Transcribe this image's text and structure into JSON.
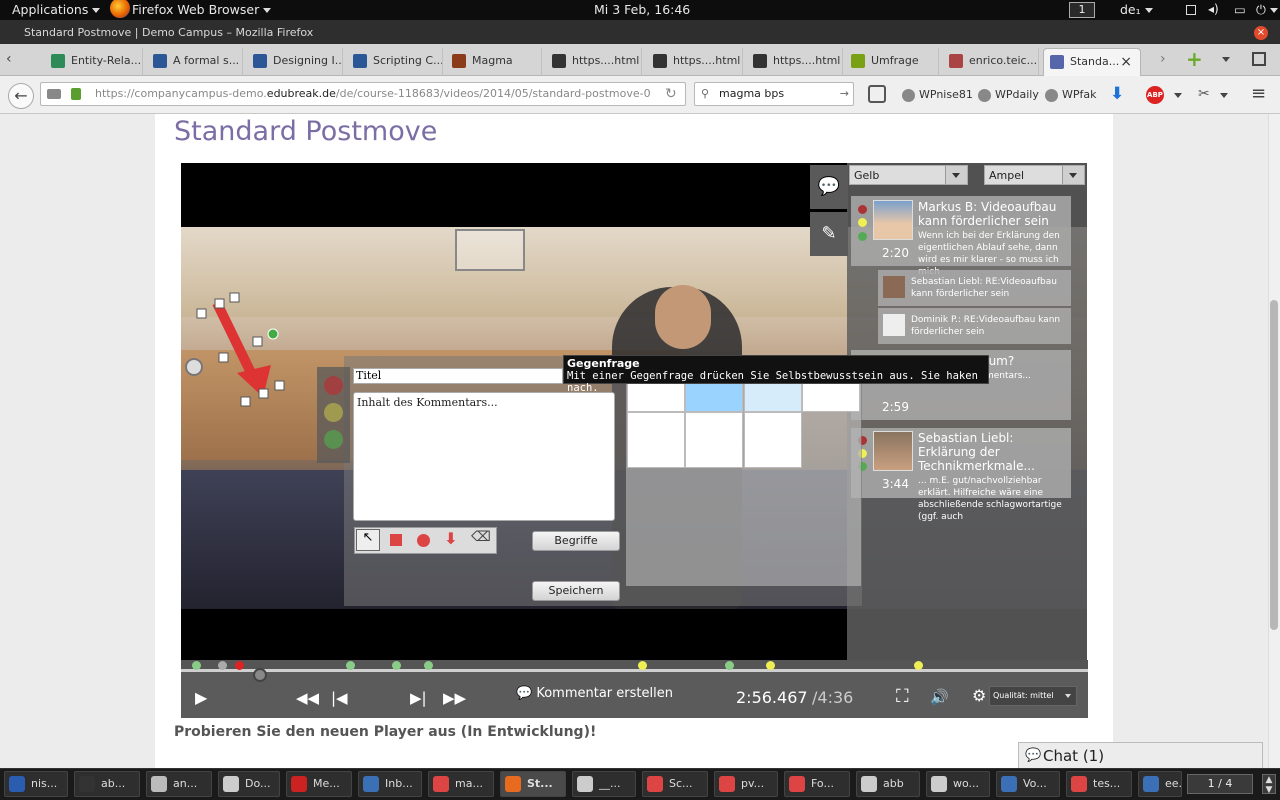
{
  "topbar": {
    "applications": "Applications",
    "app_name": "Firefox Web Browser",
    "clock": "Mi 3 Feb, 16:46",
    "workspace": "1",
    "keyboard": "de₁"
  },
  "window": {
    "title": "Standard Postmove | Demo Campus – Mozilla Firefox"
  },
  "tabs": [
    {
      "label": "Entity-Rela...",
      "color": "#2e8b57"
    },
    {
      "label": "A formal s...",
      "color": "#2b5797"
    },
    {
      "label": "Designing I...",
      "color": "#2b5797"
    },
    {
      "label": "Scripting C...",
      "color": "#2b5797"
    },
    {
      "label": "Magma",
      "color": "#8b3a1a"
    },
    {
      "label": "https....html",
      "color": "#333"
    },
    {
      "label": "https....html",
      "color": "#333"
    },
    {
      "label": "https....html",
      "color": "#333"
    },
    {
      "label": "Umfrage",
      "color": "#7aa014"
    },
    {
      "label": "enrico.teic...",
      "color": "#aa4444"
    },
    {
      "label": "Standa...",
      "color": "#5566aa"
    }
  ],
  "nav": {
    "url_prefix": "https://companycampus-demo.",
    "url_domain": "edubreak.de",
    "url_path": "/de/course-118683/videos/2014/05/standard-postmove-0",
    "search": "magma bps"
  },
  "bookmarks": [
    "WPnise81",
    "WPdaily",
    "WPfak"
  ],
  "page": {
    "title": "Standard Postmove",
    "subtitle": "Probieren Sie den neuen Player aus (In Entwicklung)!",
    "chat": "Chat (1)"
  },
  "player": {
    "filter1": "Gelb",
    "filter2": "Ampel",
    "comments": [
      {
        "title": "Markus B: Videoaufbau kann förderlicher sein",
        "text": "Wenn ich bei der Erklärung den eigentlichen Ablauf sehe, dann wird es mir klarer - so muss ich mich",
        "time": "2:20"
      },
      {
        "title": "Julia M: Warum?",
        "text": "Inhalt des Kommentars...",
        "time": "2:59"
      },
      {
        "title": "Sebastian Liebl: Erklärung der Technikmerkmale...",
        "text": "... m.E. gut/nachvollziehbar erklärt. Hilfreiche wäre eine abschließende schlagwortartige (ggf. auch",
        "time": "3:44"
      }
    ],
    "replies": [
      {
        "text": "Sebastian Liebl: RE:Videoaufbau kann förderlicher sein"
      },
      {
        "text": "Dominik P.: RE:Videoaufbau kann förderlicher sein"
      }
    ],
    "editor": {
      "title_value": "Titel",
      "body_value": "Inhalt des Kommentars...",
      "terms_button": "Begriffe",
      "save_button": "Speichern"
    },
    "tooltip": {
      "title": "Gegenfrage",
      "text": "Mit einer Gegenfrage drücken Sie Selbstbewusstsein aus. Sie haken nach."
    },
    "controls": {
      "comment_button": "Kommentar erstellen",
      "current_time": "2:56.467",
      "duration": "/4:36",
      "quality": "Qualität: mittel"
    }
  },
  "taskbar": {
    "items": [
      "nis...",
      "ab...",
      "an...",
      "Do...",
      "Me...",
      "Inb...",
      "ma...",
      "St...",
      "__...",
      "Sc...",
      "pv...",
      "Fo...",
      "abb",
      "wo...",
      "Vo...",
      "tes...",
      "ee..."
    ],
    "pager": "1 / 4"
  }
}
